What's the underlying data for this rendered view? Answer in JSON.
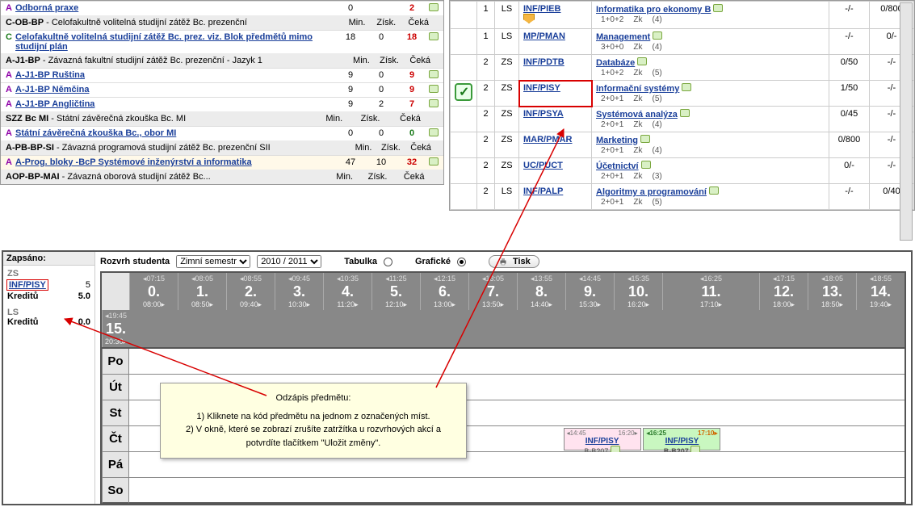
{
  "left": {
    "first_cut": {
      "status": "A",
      "title": "Odborná praxe",
      "n1": "0",
      "n2": "",
      "ceka": "2"
    },
    "blocks": [
      {
        "code": "C-OB-BP",
        "desc": "- Celofakultně volitelná studijní zátěž Bc. prezenční",
        "cols": [
          "Min.",
          "Získ.",
          "Čeká"
        ],
        "rows": [
          {
            "status": "C",
            "statusClass": "st-C",
            "title": "Celofakultně volitelná studijní zátěž Bc. prez. viz. Blok předmětů mimo studijní plán",
            "n1": "18",
            "n2": "0",
            "ceka": "18",
            "cekaClass": "red",
            "bubble": true
          }
        ]
      },
      {
        "code": "A-J1-BP",
        "desc": "- Závazná fakultní studijní zátěž Bc. prezenční - Jazyk 1",
        "cols": [
          "Min.",
          "Získ.",
          "Čeká"
        ],
        "rows": [
          {
            "status": "A",
            "statusClass": "st-A",
            "title": "A-J1-BP Ruština",
            "n1": "9",
            "n2": "0",
            "ceka": "9",
            "cekaClass": "red",
            "bubble": true
          },
          {
            "status": "A",
            "statusClass": "st-A",
            "title": "A-J1-BP Němčina",
            "n1": "9",
            "n2": "0",
            "ceka": "9",
            "cekaClass": "red",
            "bubble": true
          },
          {
            "status": "A",
            "statusClass": "st-A",
            "title": "A-J1-BP Angličtina",
            "n1": "9",
            "n2": "2",
            "ceka": "7",
            "cekaClass": "red",
            "bubble": true
          }
        ]
      },
      {
        "code": "SZZ Bc MI",
        "desc": "- Státní závěrečná zkouška Bc. MI",
        "cols": [
          "Min.",
          "Získ.",
          "Čeká"
        ],
        "rows": [
          {
            "status": "A",
            "statusClass": "st-A",
            "title": "Státní závěrečná zkouška Bc., obor MI",
            "n1": "0",
            "n2": "0",
            "ceka": "0",
            "cekaClass": "green",
            "bubble": true
          }
        ]
      },
      {
        "code": "A-PB-BP-SI",
        "desc": "- Závazná programová studijní zátěž Bc. prezenční SII",
        "cols": [
          "Min.",
          "Získ.",
          "Čeká"
        ],
        "rows": [
          {
            "status": "A",
            "statusClass": "st-A",
            "title": "A-Prog. bloky -BcP Systémové inženýrství a informatika",
            "n1": "47",
            "n2": "10",
            "ceka": "32",
            "cekaClass": "red",
            "bubble": true,
            "light": true
          }
        ]
      },
      {
        "code": "AOP-BP-MAI",
        "desc": "- Závazná oborová studijní zátěž Bc...",
        "cols": [
          "Min.",
          "Získ.",
          "Čeká"
        ],
        "rows": []
      }
    ]
  },
  "right": {
    "rows": [
      {
        "check": "",
        "n": "1",
        "sem": "LS",
        "code": "INF/PIEB",
        "flag": true,
        "name": "Informatika pro ekonomy B",
        "det": "1+0+2",
        "zk": "Zk",
        "hrs": "(4)",
        "r1": "-/-",
        "r2": "0/800"
      },
      {
        "check": "",
        "n": "1",
        "sem": "LS",
        "code": "MP/PMAN",
        "name": "Management",
        "det": "3+0+0",
        "zk": "Zk",
        "hrs": "(4)",
        "r1": "-/-",
        "r2": "0/-"
      },
      {
        "check": "",
        "n": "2",
        "sem": "ZS",
        "code": "INF/PDTB",
        "name": "Databáze",
        "det": "1+0+2",
        "zk": "Zk",
        "hrs": "(5)",
        "r1": "0/50",
        "r2": "-/-"
      },
      {
        "check": "on",
        "n": "2",
        "sem": "ZS",
        "code": "INF/PISY",
        "hl": true,
        "name": "Informační systémy",
        "det": "2+0+1",
        "zk": "Zk",
        "hrs": "(5)",
        "r1": "1/50",
        "r2": "-/-"
      },
      {
        "check": "",
        "n": "2",
        "sem": "ZS",
        "code": "INF/PSYA",
        "name": "Systémová analýza",
        "det": "2+0+1",
        "zk": "Zk",
        "hrs": "(4)",
        "r1": "0/45",
        "r2": "-/-"
      },
      {
        "check": "",
        "n": "2",
        "sem": "ZS",
        "code": "MAR/PMAR",
        "name": "Marketing",
        "det": "2+0+1",
        "zk": "Zk",
        "hrs": "(4)",
        "r1": "0/800",
        "r2": "-/-"
      },
      {
        "check": "",
        "n": "2",
        "sem": "ZS",
        "code": "UC/PUCT",
        "name": "Účetnictví",
        "det": "2+0+1",
        "zk": "Zk",
        "hrs": "(3)",
        "r1": "0/-",
        "r2": "-/-"
      },
      {
        "check": "",
        "n": "2",
        "sem": "LS",
        "code": "INF/PALP",
        "name": "Algoritmy a programování",
        "det": "2+0+1",
        "zk": "Zk",
        "hrs": "(5)",
        "r1": "-/-",
        "r2": "0/40"
      }
    ]
  },
  "bottom": {
    "zapsano": "Zapsáno:",
    "zs_label": "ZS",
    "zs_code": "INF/PISY",
    "zs_count": "5",
    "kreditu": "Kreditů",
    "zs_kred": "5.0",
    "ls_label": "LS",
    "ls_kred": "0.0",
    "toolbar": {
      "title": "Rozvrh studenta",
      "sem_opt": "Zimní semestr",
      "year_opt": "2010 / 2011",
      "tabulka": "Tabulka",
      "graficke": "Grafické",
      "tisk": "Tisk"
    },
    "times": [
      {
        "nr": "0.",
        "t1": "07:15",
        "t2": "08:00"
      },
      {
        "nr": "1.",
        "t1": "08:05",
        "t2": "08:50"
      },
      {
        "nr": "2.",
        "t1": "08:55",
        "t2": "09:40"
      },
      {
        "nr": "3.",
        "t1": "09:45",
        "t2": "10:30"
      },
      {
        "nr": "4.",
        "t1": "10:35",
        "t2": "11:20"
      },
      {
        "nr": "5.",
        "t1": "11:25",
        "t2": "12:10"
      },
      {
        "nr": "6.",
        "t1": "12:15",
        "t2": "13:00"
      },
      {
        "nr": "7.",
        "t1": "13:05",
        "t2": "13:50"
      },
      {
        "nr": "8.",
        "t1": "13:55",
        "t2": "14:40"
      },
      {
        "nr": "9.",
        "t1": "14:45",
        "t2": "15:30"
      },
      {
        "nr": "10.",
        "t1": "15:35",
        "t2": "16:20"
      },
      {
        "nr": "11.",
        "t1": "16:25",
        "t2": "17:10",
        "wide": true
      },
      {
        "nr": "12.",
        "t1": "17:15",
        "t2": "18:00"
      },
      {
        "nr": "13.",
        "t1": "18:05",
        "t2": "18:50"
      },
      {
        "nr": "14.",
        "t1": "18:55",
        "t2": "19:40"
      },
      {
        "nr": "15.",
        "t1": "19:45",
        "t2": "20:30"
      }
    ],
    "days": [
      "Po",
      "Út",
      "St",
      "Čt",
      "Pá",
      "So"
    ],
    "events": [
      {
        "day": "Čt",
        "cls": "pink",
        "left": "56%",
        "width": "10%",
        "t1": "14:45",
        "t2": "16:20",
        "code": "INF/PISY",
        "room": "B-B207"
      },
      {
        "day": "Čt",
        "cls": "green",
        "left": "66.3%",
        "width": "10%",
        "t1": "16:25",
        "t2": "17:10",
        "code": "INF/PISY",
        "room": "B-B207"
      }
    ],
    "note": {
      "title": "Odzápis předmětu:",
      "l1": "1) Kliknete na kód předmětu na jednom z označených míst.",
      "l2": "2) V okně, které se zobrazí zrušíte zatržítka u rozvrhových akcí a potvrdíte tlačítkem \"Uložit změny\"."
    }
  }
}
